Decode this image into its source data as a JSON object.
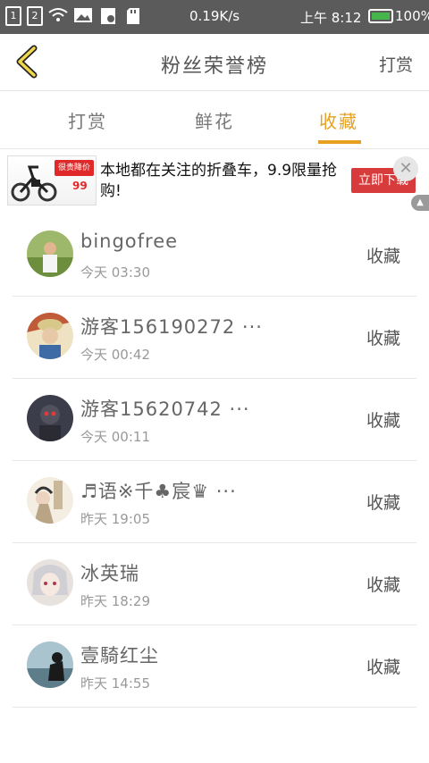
{
  "status_bar": {
    "sim1": "1",
    "sim2": "2",
    "speed": "0.19K/s",
    "time": "上午 8:12",
    "battery": "100%",
    "battery_color": "#46b54b"
  },
  "header": {
    "title": "粉丝荣誉榜",
    "right_action": "打赏",
    "back_icon": "chevron-left-icon",
    "accent": "#e8a020"
  },
  "tabs": [
    {
      "label": "打赏",
      "active": false
    },
    {
      "label": "鲜花",
      "active": false
    },
    {
      "label": "收藏",
      "active": true
    }
  ],
  "ad": {
    "text": "本地都在关注的折叠车，9.9限量抢购!",
    "badge": "很贵降价了",
    "price": "99",
    "button": "立即下载",
    "close_icon": "close-icon"
  },
  "list": [
    {
      "name": "bingofree",
      "time": "今天 03:30",
      "action": "收藏",
      "avatar_color": "#6d8f3d"
    },
    {
      "name": "游客156190272 ···",
      "time": "今天 00:42",
      "action": "收藏",
      "avatar_color": "#c05b3a"
    },
    {
      "name": "游客15620742 ···",
      "time": "今天 00:11",
      "action": "收藏",
      "avatar_color": "#3b3d4a"
    },
    {
      "name": "♬语※千♣宸♛ ···",
      "time": "昨天 19:05",
      "action": "收藏",
      "avatar_color": "#d7c8b0"
    },
    {
      "name": "冰英瑞",
      "time": "昨天 18:29",
      "action": "收藏",
      "avatar_color": "#e8e2de"
    },
    {
      "name": "壹騎红尘",
      "time": "昨天 14:55",
      "action": "收藏",
      "avatar_color": "#7d9aa8"
    }
  ]
}
